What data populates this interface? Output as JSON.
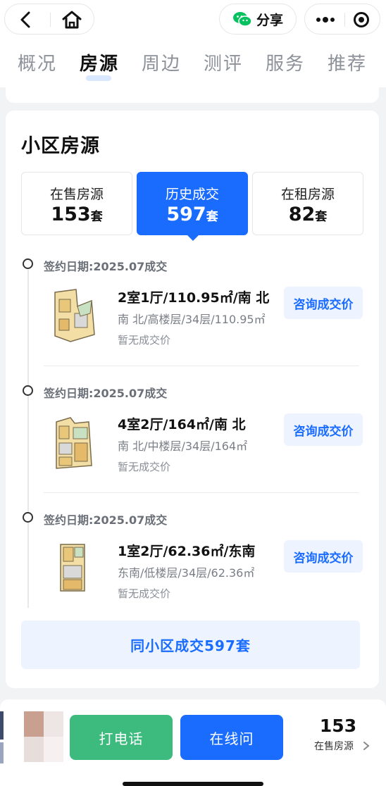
{
  "nav": {
    "share_label": "分享",
    "tabs": [
      "概况",
      "房源",
      "周边",
      "测评",
      "服务",
      "推荐"
    ],
    "active_tab": "房源"
  },
  "section": {
    "title": "小区房源",
    "stats": [
      {
        "label": "在售房源",
        "count": "153",
        "unit": "套"
      },
      {
        "label": "历史成交",
        "count": "597",
        "unit": "套"
      },
      {
        "label": "在租房源",
        "count": "82",
        "unit": "套"
      }
    ],
    "active_stat": "历史成交"
  },
  "records": [
    {
      "date": "签约日期:2025.07成交",
      "title": "2室1厅/110.95㎡/南 北",
      "detail": "南 北/高楼层/34层/110.95㎡",
      "price": "暂无成交价",
      "button": "咨询成交价"
    },
    {
      "date": "签约日期:2025.07成交",
      "title": "4室2厅/164㎡/南 北",
      "detail": "南 北/中楼层/34层/164㎡",
      "price": "暂无成交价",
      "button": "咨询成交价"
    },
    {
      "date": "签约日期:2025.07成交",
      "title": "1室2厅/62.36㎡/东南",
      "detail": "东南/低楼层/34层/62.36㎡",
      "price": "暂无成交价",
      "button": "咨询成交价"
    }
  ],
  "more_button": "同小区成交597套",
  "bottom": {
    "call_label": "打电话",
    "online_label": "在线问",
    "sale_count": "153",
    "sale_label": "在售房源"
  },
  "colors": {
    "accent": "#1a6cff",
    "call_green": "#3dbb7f",
    "soft_blue": "#eef4ff"
  },
  "icons": [
    "back-icon",
    "home-icon",
    "wechat-icon",
    "more-dots-icon",
    "target-icon",
    "chevron-right-icon"
  ]
}
